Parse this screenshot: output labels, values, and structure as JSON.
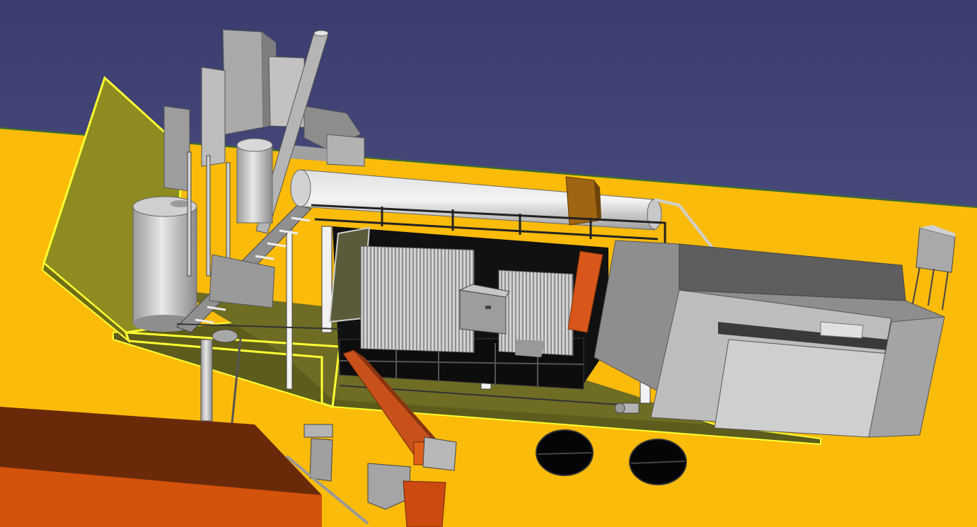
{
  "viewport": {
    "background_top": "#3a3d6e",
    "background_bottom": "#5a5c8a",
    "ground_color": "#fbbb0b",
    "ground_edge_color": "#2f6b2f",
    "selection_color": "#ffff33",
    "selected_wall_color": "#8e8c20",
    "platform_color": "#5d5c1c",
    "equipment_gray": "#b8b8b8",
    "equipment_dark": "#111111",
    "pipe_orange": "#cc4a10",
    "roof_brown": "#6a2a0a",
    "roof_orange": "#d3520c",
    "tank_brown": "#a06512"
  },
  "scene": {
    "objects": [
      "ground-plane",
      "selected-retaining-wall",
      "platform-slab",
      "exhaust-stack",
      "vertical-storage-tank",
      "horizontal-drum-tank",
      "service-staircase",
      "radiator-unit-left",
      "radiator-unit-right",
      "control-cabinet",
      "main-enclosure-building",
      "roof-water-tank",
      "conveyor-chute",
      "pump-unit",
      "drain-pit-left",
      "drain-pit-right",
      "adjacent-building-roof",
      "hopper-feeder"
    ]
  }
}
